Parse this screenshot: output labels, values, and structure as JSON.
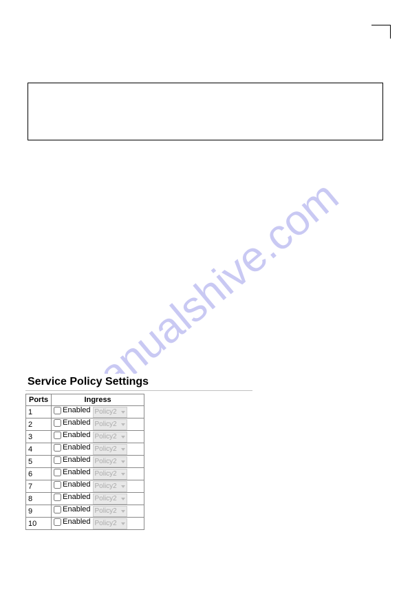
{
  "watermark": "manualshive.com",
  "panel": {
    "title": "Service Policy Settings",
    "headers": {
      "ports": "Ports",
      "ingress": "Ingress"
    },
    "enabled_label": "Enabled",
    "policy_value": "Policy2",
    "rows": [
      {
        "port": "1"
      },
      {
        "port": "2"
      },
      {
        "port": "3"
      },
      {
        "port": "4"
      },
      {
        "port": "5"
      },
      {
        "port": "6"
      },
      {
        "port": "7"
      },
      {
        "port": "8"
      },
      {
        "port": "9"
      },
      {
        "port": "10"
      }
    ]
  }
}
